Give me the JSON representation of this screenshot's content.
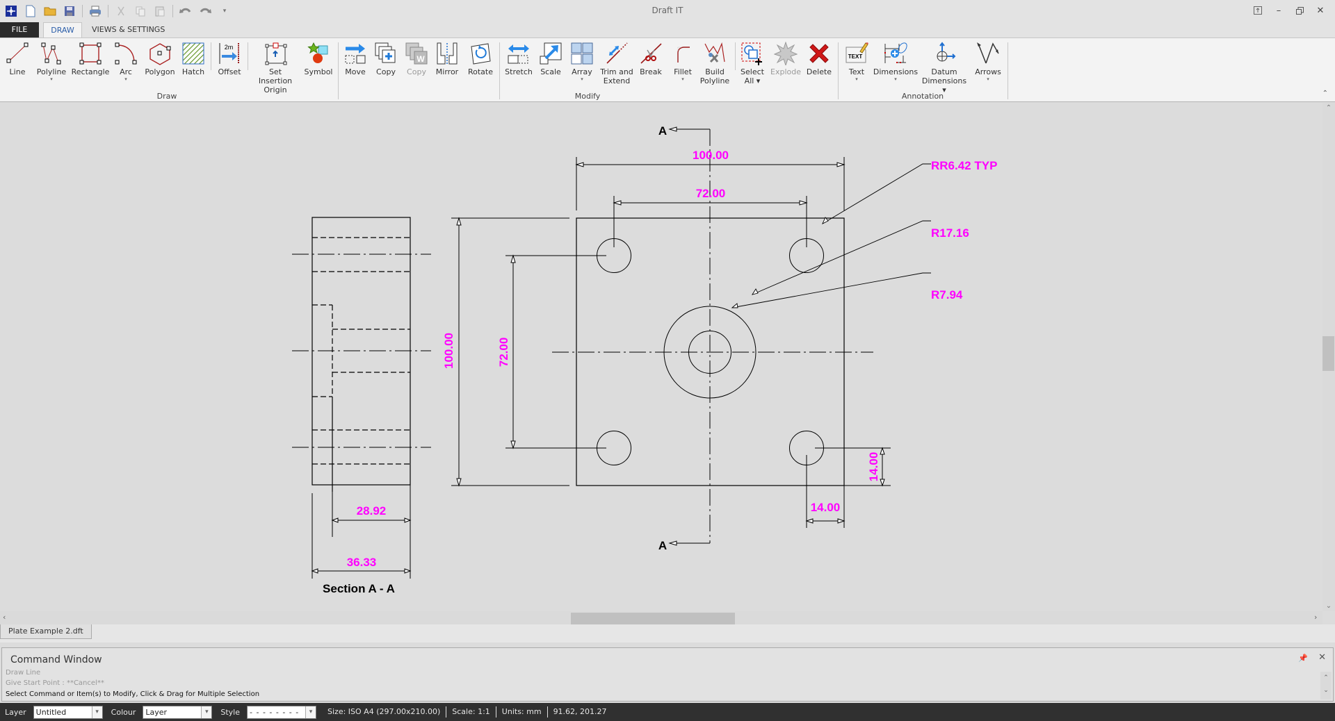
{
  "app": {
    "title": "Draft IT"
  },
  "quick_access": [
    "app-logo-icon",
    "new-file-icon",
    "open-folder-icon",
    "save-icon",
    "print-icon",
    "cut-icon",
    "copy-icon",
    "paste-icon",
    "undo-icon",
    "redo-icon",
    "customize-dropdown-icon"
  ],
  "tabs": [
    {
      "label": "FILE"
    },
    {
      "label": "DRAW",
      "active": true
    },
    {
      "label": "VIEWS & SETTINGS"
    }
  ],
  "view_tools": [
    "zoom-previous-icon",
    "zoom-window-icon",
    "zoom-extents-icon",
    "grid-icon",
    "snap-icon",
    "ortho-lock-icon",
    "angle-lock-icon",
    "refresh-icon",
    "help-icon",
    "info-icon",
    "close-drawing-icon"
  ],
  "window_controls": [
    "ribbon-display-icon",
    "minimize-icon",
    "restore-icon",
    "close-icon"
  ],
  "ribbon": {
    "groups": [
      {
        "label": "Draw"
      },
      {
        "label": "Modify"
      },
      {
        "label": "Annotation"
      }
    ],
    "buttons": [
      {
        "label": "Line",
        "icon": "line-icon"
      },
      {
        "label": "Polyline",
        "icon": "polyline-icon",
        "dropdown": true
      },
      {
        "label": "Rectangle",
        "icon": "rectangle-icon"
      },
      {
        "label": "Arc",
        "icon": "arc-icon",
        "dropdown": true
      },
      {
        "label": "Polygon",
        "icon": "polygon-icon"
      },
      {
        "label": "Hatch",
        "icon": "hatch-icon"
      },
      {
        "label": "Offset",
        "icon": "offset-icon",
        "badge": "2m"
      },
      {
        "label": "Set Insertion\nOrigin",
        "l1": "Set Insertion",
        "l2": "Origin",
        "icon": "insertion-origin-icon"
      },
      {
        "label": "Symbol",
        "icon": "symbol-icon"
      },
      {
        "label": "Move",
        "icon": "move-icon"
      },
      {
        "label": "Copy",
        "icon": "copy-icon"
      },
      {
        "label": "Copy",
        "icon": "copy-format-icon",
        "disabled": true
      },
      {
        "label": "Mirror",
        "icon": "mirror-icon"
      },
      {
        "label": "Rotate",
        "icon": "rotate-icon"
      },
      {
        "label": "Stretch",
        "icon": "stretch-icon"
      },
      {
        "label": "Scale",
        "icon": "scale-icon"
      },
      {
        "label": "Array",
        "icon": "array-icon",
        "dropdown": true
      },
      {
        "label": "Trim and\nExtend",
        "l1": "Trim and",
        "l2": "Extend",
        "icon": "trim-extend-icon"
      },
      {
        "label": "Break",
        "icon": "break-icon"
      },
      {
        "label": "Fillet",
        "icon": "fillet-icon",
        "dropdown": true
      },
      {
        "label": "Build\nPolyline",
        "l1": "Build",
        "l2": "Polyline",
        "icon": "build-polyline-icon"
      },
      {
        "label": "Select\nAll",
        "l1": "Select",
        "l2": "All ▾",
        "icon": "select-all-icon"
      },
      {
        "label": "Explode",
        "icon": "explode-icon",
        "disabled": true
      },
      {
        "label": "Delete",
        "icon": "delete-icon"
      },
      {
        "label": "Text",
        "icon": "text-icon",
        "dropdown": true,
        "badge": "TEXT"
      },
      {
        "label": "Dimensions",
        "icon": "dimensions-icon",
        "dropdown": true
      },
      {
        "label": "Datum\nDimensions",
        "l1": "Datum",
        "l2": "Dimensions ▾",
        "icon": "datum-dimensions-icon"
      },
      {
        "label": "Arrows",
        "icon": "arrows-icon",
        "dropdown": true
      }
    ]
  },
  "drawing": {
    "colors": {
      "line": "#000000",
      "dimension_text": "#ff00ff",
      "background": "#dcdcdc"
    },
    "section_marker": "A",
    "section_title": "Section A - A",
    "dimensions": {
      "plate_width": "100.00",
      "hole_spacing_x": "72.00",
      "plate_height": "100.00",
      "hole_spacing_y": "72.00",
      "hole_offset_x": "14.00",
      "hole_offset_y": "14.00",
      "section_inner_depth": "28.92",
      "section_thickness": "36.33"
    },
    "callouts": {
      "corner_holes": "RR6.42 TYP",
      "counterbore": "R17.16",
      "center_hole": "R7.94"
    }
  },
  "document_tab": "Plate Example 2.dft",
  "command_window": {
    "title": "Command Window",
    "history": [
      "Draw Line",
      "Give Start Point :  **Cancel**"
    ],
    "prompt": "Select Command or Item(s) to Modify, Click & Drag for Multiple Selection"
  },
  "status_bar": {
    "layer_label": "Layer",
    "layer_value": "Untitled",
    "colour_label": "Colour",
    "colour_value": "Layer",
    "style_label": "Style",
    "style_value": "- - - - - - - -",
    "size": "Size: ISO A4 (297.00x210.00)",
    "scale": "Scale: 1:1",
    "units": "Units: mm",
    "coordinates": "91.62, 201.27"
  }
}
